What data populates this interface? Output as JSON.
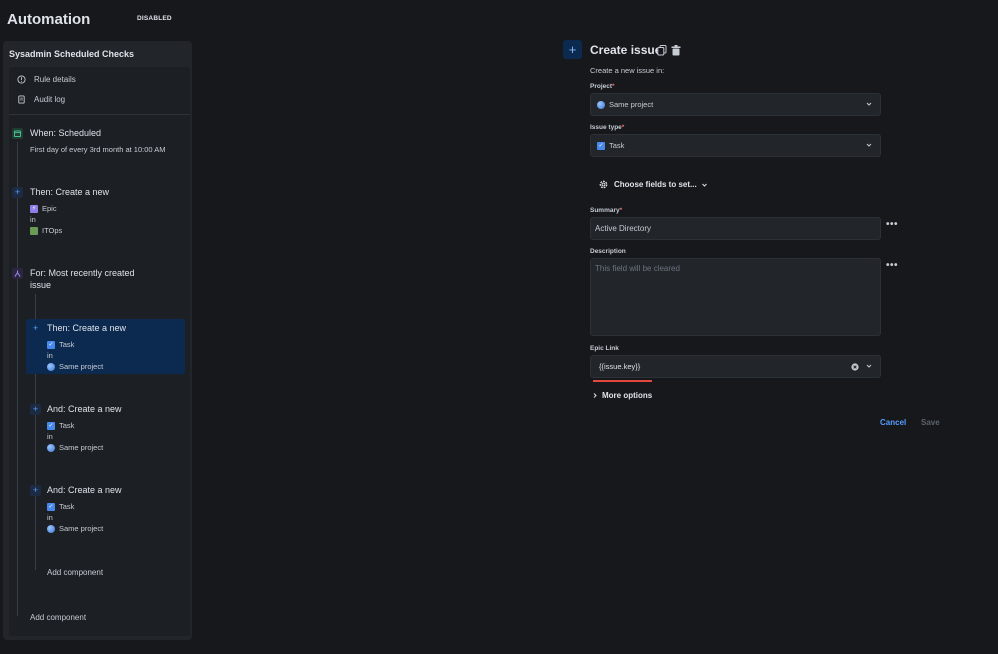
{
  "header": {
    "title": "Automation",
    "status_badge": "DISABLED"
  },
  "rule": {
    "name": "Sysadmin Scheduled Checks",
    "menu": [
      {
        "label": "Rule details",
        "icon": "info-icon"
      },
      {
        "label": "Audit log",
        "icon": "document-icon"
      }
    ],
    "trigger": {
      "title": "When: Scheduled",
      "detail": "First day of every 3rd month at 10:00 AM",
      "icon": "calendar-icon"
    },
    "action1": {
      "title": "Then: Create a new",
      "issue_type": "Epic",
      "in_label": "in",
      "project": "ITOps",
      "icon": "plus-icon"
    },
    "branch": {
      "title_line1": "For: Most recently created",
      "title_line2": "issue",
      "icon": "branch-icon"
    },
    "sub_actions": [
      {
        "title": "Then: Create a new",
        "issue_type": "Task",
        "in_label": "in",
        "project": "Same project",
        "selected": true
      },
      {
        "title": "And: Create a new",
        "issue_type": "Task",
        "in_label": "in",
        "project": "Same project",
        "selected": false
      },
      {
        "title": "And: Create a new",
        "issue_type": "Task",
        "in_label": "in",
        "project": "Same project",
        "selected": false
      }
    ],
    "add_component_inner": "Add component",
    "add_component_outer": "Add component"
  },
  "form": {
    "title": "Create issue",
    "subtitle": "Create a new issue in:",
    "project_label": "Project",
    "project_value": "Same project",
    "issue_type_label": "Issue type",
    "issue_type_value": "Task",
    "choose_fields": "Choose fields to set...",
    "summary_label": "Summary",
    "summary_value": "Active Directory",
    "description_label": "Description",
    "description_placeholder": "This field will be cleared",
    "epic_link_label": "Epic Link",
    "epic_link_value": "{{issue.key}}",
    "more_options": "More options",
    "required_marker": "*",
    "cancel": "Cancel",
    "save": "Save"
  },
  "colors": {
    "accent": "#579dff",
    "selected_bg": "#0c2a4f",
    "error": "#e2483d"
  }
}
